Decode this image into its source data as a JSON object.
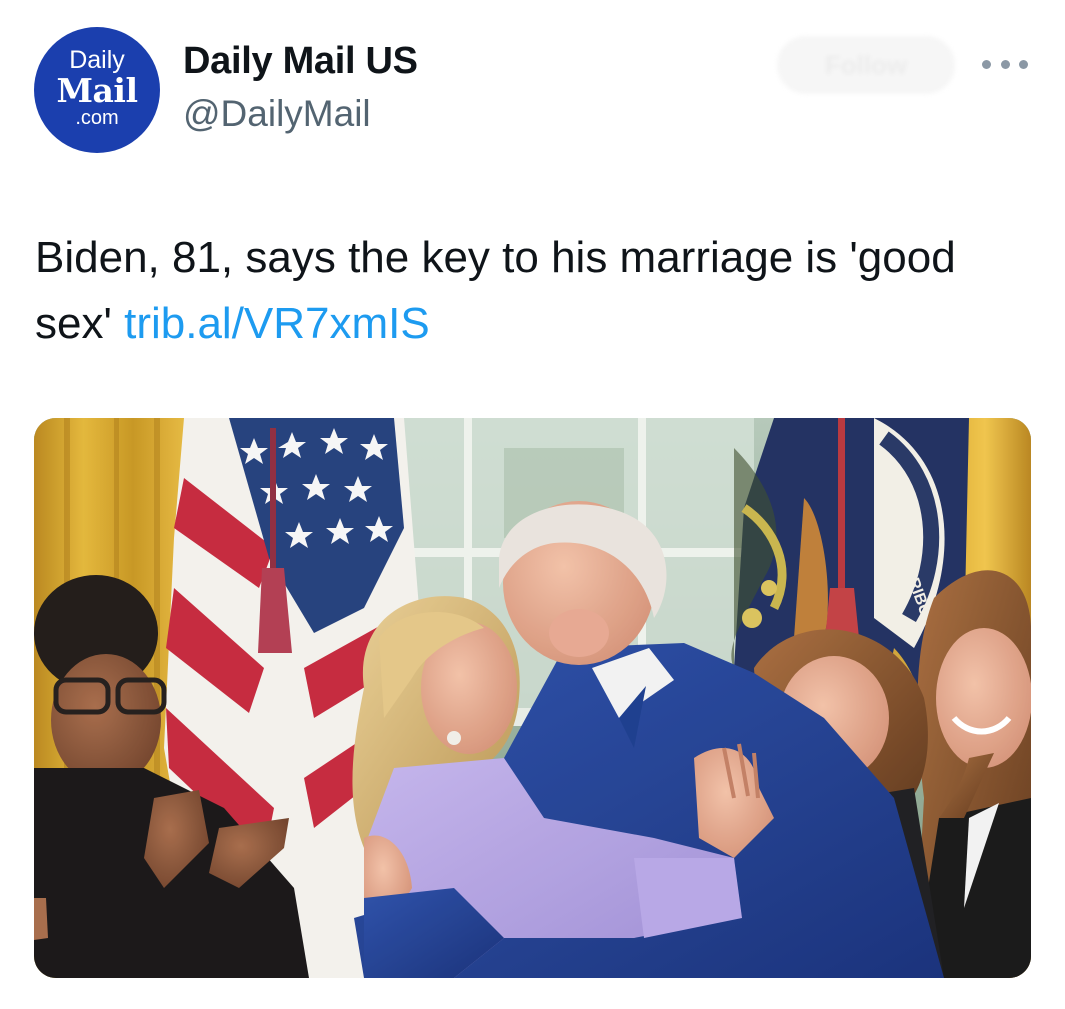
{
  "account": {
    "avatar_line1": "Daily",
    "avatar_line2": "Mail",
    "avatar_line3": ".com",
    "display_name": "Daily Mail US",
    "handle": "@DailyMail",
    "follow_label": "Follow"
  },
  "post": {
    "text": "Biden, 81, says the key to his marriage is 'good sex' ",
    "link_text": "trib.al/VR7xmIS",
    "flag_text": "E PLURIBUS"
  },
  "colors": {
    "brand_avatar": "#1b3fae",
    "link": "#1d9bf0",
    "handle_gray": "#536471"
  },
  "icons": {
    "more": "more-horizontal-icon"
  }
}
